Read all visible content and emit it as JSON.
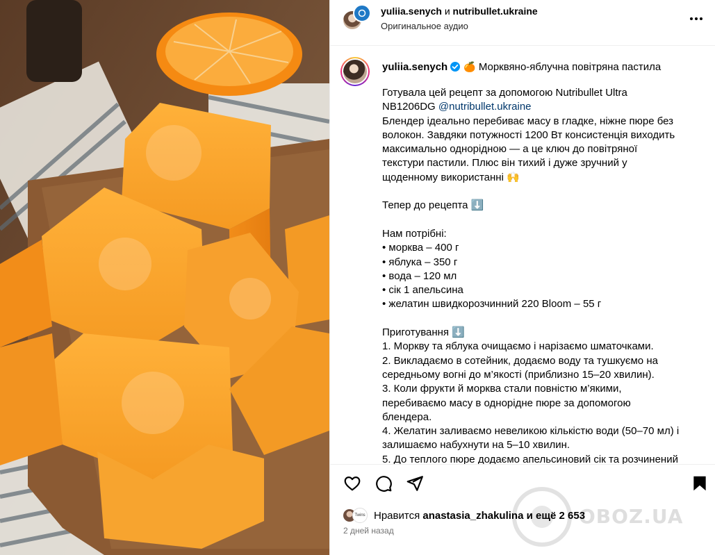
{
  "header": {
    "user": "yuliia.senych",
    "joiner": "и",
    "collab": "nutribullet.ukraine",
    "audio": "Оригинальное аудио"
  },
  "caption": {
    "user": "yuliia.senych",
    "emoji": "🍊",
    "title": "Морквяно-яблучна повітряна пастила",
    "intro_prefix": "Готувала цей рецепт за допомогою Nutribullet Ultra\nNB1206DG ",
    "mention": "@nutribullet.ukraine",
    "body": "Блендер ідеально перебиває масу в гладке, ніжне пюре без\nволокон. Завдяки потужності 1200 Вт консистенція виходить\nмаксимально однорідною — а це ключ до повітряної\nтекстури пастили. Плюс він тихий і дуже зручний у\nщоденному використанні 🙌\n\nТепер до рецепта ⬇️\n\nНам потрібні:\n• морква – 400 г\n• яблука – 350 г\n• вода – 120 мл\n• сік 1 апельсина\n• желатин швидкорозчинний 220 Bloom – 55 г\n\nПриготування ⬇️\n1. Моркву та яблука очищаємо і нарізаємо шматочками.\n2. Викладаємо в сотейник, додаємо воду та тушкуємо на\nсередньому вогні до м’якості (приблизно 15–20 хвилин).\n3. Коли фрукти й морква стали повністю м’якими,\nперебиваємо масу в однорідне пюре за допомогою\nблендера.\n4. Желатин заливаємо невеликою кількістю води (50–70 мл) і\nзалишаємо набухнути на 5–10 хвилин.\n5. До теплого пюре додаємо апельсиновий сік та розчинений"
  },
  "likes": {
    "prefix": "Нравится ",
    "user": "anastasia_zhakulina",
    "suffix": " и ещё 2 653",
    "mini_avatar_label": "Twins"
  },
  "time": "2 дней назад",
  "watermark": "OBOZ.UA"
}
